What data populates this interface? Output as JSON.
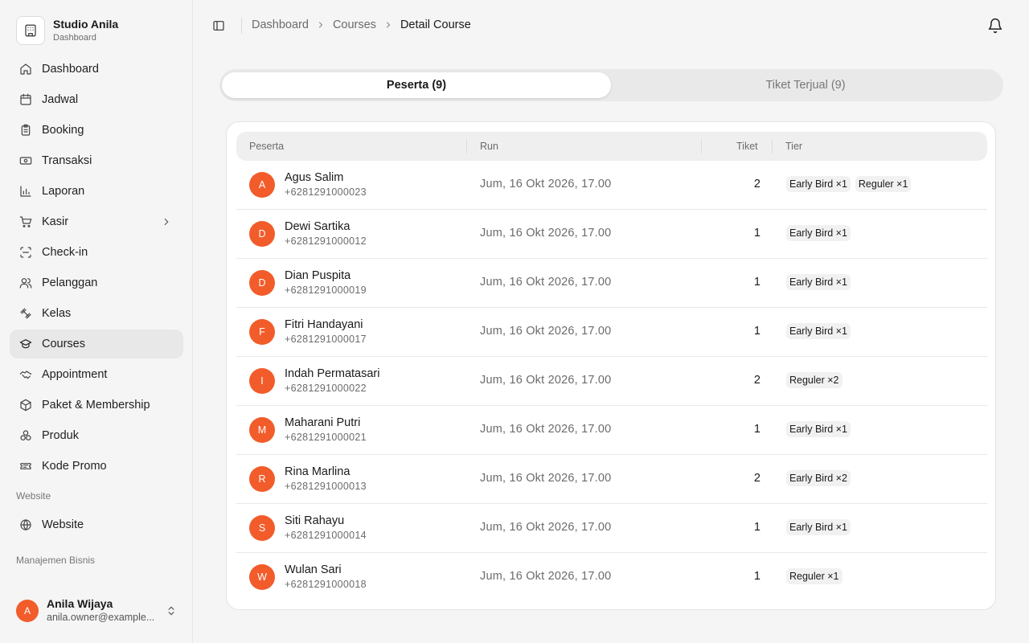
{
  "brand": {
    "name": "Studio Anila",
    "subtitle": "Dashboard"
  },
  "sidebar": {
    "items": [
      {
        "label": "Dashboard",
        "icon": "home-icon"
      },
      {
        "label": "Jadwal",
        "icon": "calendar-icon"
      },
      {
        "label": "Booking",
        "icon": "clipboard-icon"
      },
      {
        "label": "Transaksi",
        "icon": "banknote-icon"
      },
      {
        "label": "Laporan",
        "icon": "bar-chart-icon"
      },
      {
        "label": "Kasir",
        "icon": "cart-icon",
        "has_submenu": true
      },
      {
        "label": "Check-in",
        "icon": "scan-icon"
      },
      {
        "label": "Pelanggan",
        "icon": "users-icon"
      },
      {
        "label": "Kelas",
        "icon": "dumbbell-icon"
      },
      {
        "label": "Courses",
        "icon": "graduation-cap-icon",
        "active": true
      },
      {
        "label": "Appointment",
        "icon": "handshake-icon"
      },
      {
        "label": "Paket & Membership",
        "icon": "package-icon"
      },
      {
        "label": "Produk",
        "icon": "boxes-icon"
      },
      {
        "label": "Kode Promo",
        "icon": "ticket-icon"
      }
    ],
    "section_website": "Website",
    "website_item": {
      "label": "Website",
      "icon": "globe-icon"
    },
    "section_business": "Manajemen Bisnis"
  },
  "user": {
    "initial": "A",
    "name": "Anila Wijaya",
    "email": "anila.owner@example..."
  },
  "breadcrumb": [
    "Dashboard",
    "Courses",
    "Detail Course"
  ],
  "tabs": [
    {
      "label": "Peserta (9)",
      "active": true
    },
    {
      "label": "Tiket Terjual (9)",
      "active": false
    }
  ],
  "table": {
    "headers": {
      "peserta": "Peserta",
      "run": "Run",
      "tiket": "Tiket",
      "tier": "Tier"
    },
    "rows": [
      {
        "initial": "A",
        "name": "Agus Salim",
        "phone": "+6281291000023",
        "run": "Jum, 16 Okt 2026, 17.00",
        "tiket": "2",
        "tiers": [
          "Early Bird ×1",
          "Reguler ×1"
        ]
      },
      {
        "initial": "D",
        "name": "Dewi Sartika",
        "phone": "+6281291000012",
        "run": "Jum, 16 Okt 2026, 17.00",
        "tiket": "1",
        "tiers": [
          "Early Bird ×1"
        ]
      },
      {
        "initial": "D",
        "name": "Dian Puspita",
        "phone": "+6281291000019",
        "run": "Jum, 16 Okt 2026, 17.00",
        "tiket": "1",
        "tiers": [
          "Early Bird ×1"
        ]
      },
      {
        "initial": "F",
        "name": "Fitri Handayani",
        "phone": "+6281291000017",
        "run": "Jum, 16 Okt 2026, 17.00",
        "tiket": "1",
        "tiers": [
          "Early Bird ×1"
        ]
      },
      {
        "initial": "I",
        "name": "Indah Permatasari",
        "phone": "+6281291000022",
        "run": "Jum, 16 Okt 2026, 17.00",
        "tiket": "2",
        "tiers": [
          "Reguler ×2"
        ]
      },
      {
        "initial": "M",
        "name": "Maharani Putri",
        "phone": "+6281291000021",
        "run": "Jum, 16 Okt 2026, 17.00",
        "tiket": "1",
        "tiers": [
          "Early Bird ×1"
        ]
      },
      {
        "initial": "R",
        "name": "Rina Marlina",
        "phone": "+6281291000013",
        "run": "Jum, 16 Okt 2026, 17.00",
        "tiket": "2",
        "tiers": [
          "Early Bird ×2"
        ]
      },
      {
        "initial": "S",
        "name": "Siti Rahayu",
        "phone": "+6281291000014",
        "run": "Jum, 16 Okt 2026, 17.00",
        "tiket": "1",
        "tiers": [
          "Early Bird ×1"
        ]
      },
      {
        "initial": "W",
        "name": "Wulan Sari",
        "phone": "+6281291000018",
        "run": "Jum, 16 Okt 2026, 17.00",
        "tiket": "1",
        "tiers": [
          "Reguler ×1"
        ]
      }
    ]
  },
  "colors": {
    "accent": "#f25c2a",
    "active_nav": "#e8e8e8",
    "background": "#f5f5f5"
  }
}
